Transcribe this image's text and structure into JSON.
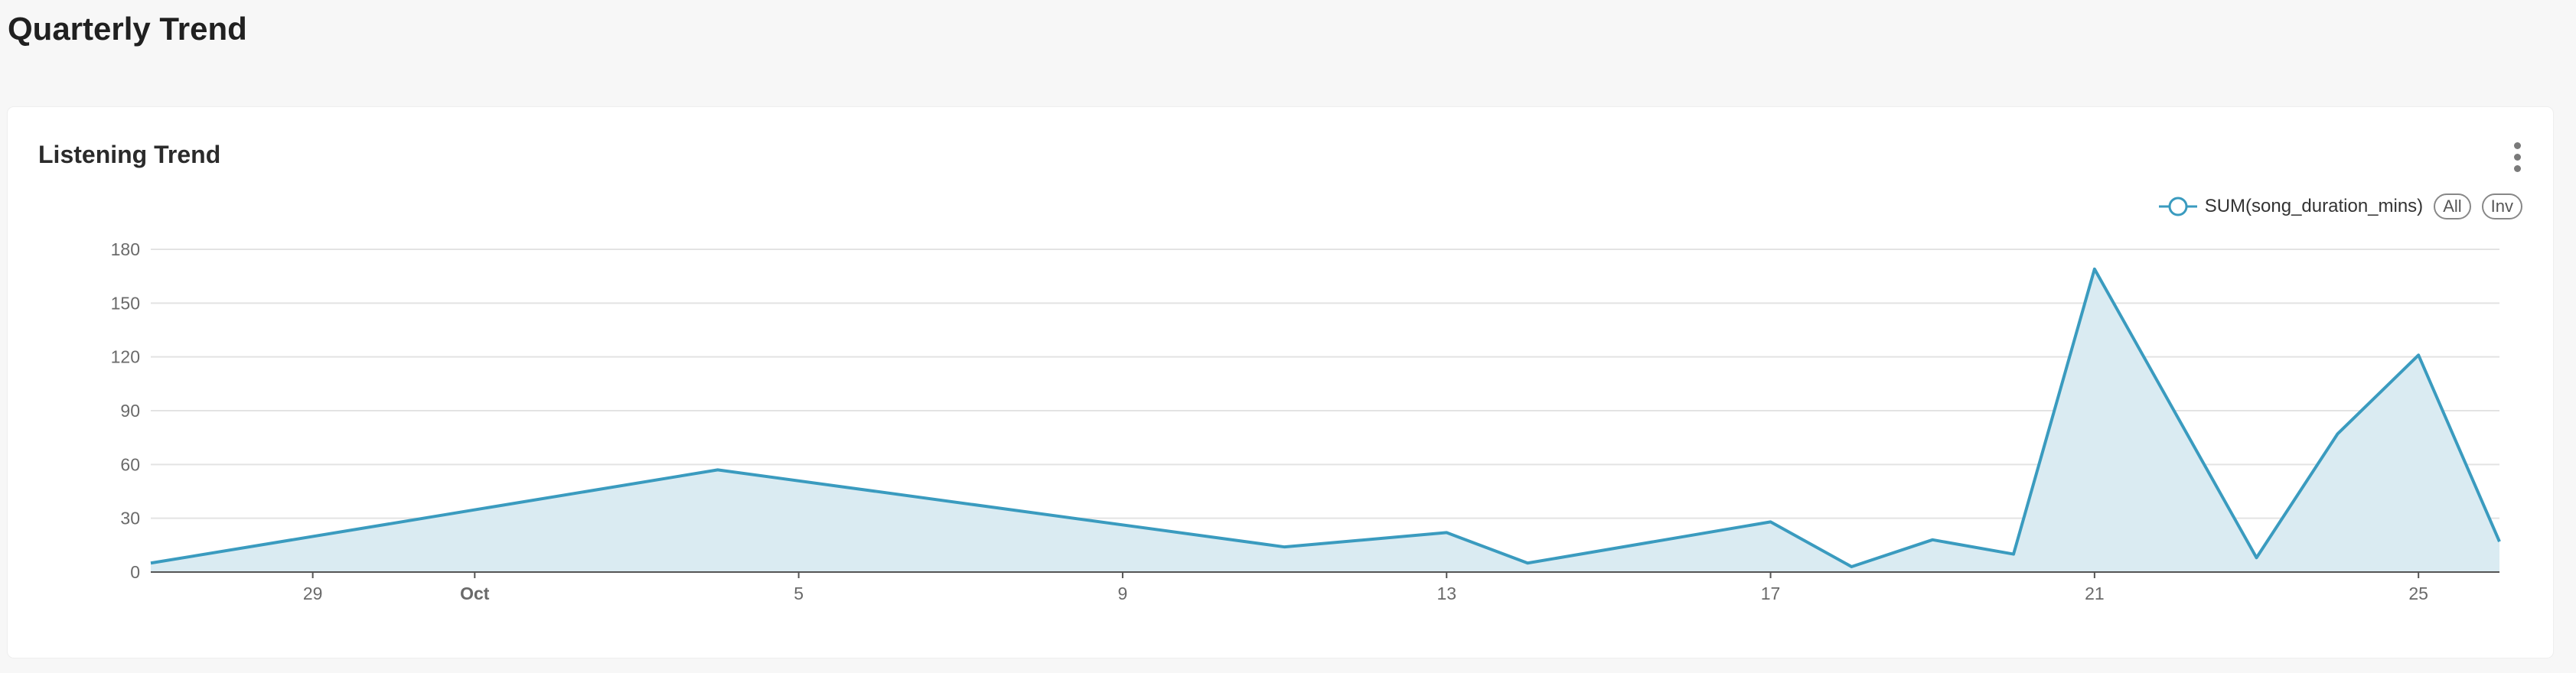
{
  "page": {
    "title": "Quarterly Trend"
  },
  "card": {
    "title": "Listening Trend",
    "menu_icon": "more-vertical-icon"
  },
  "legend": {
    "series_label": "SUM(song_duration_mins)",
    "all_label": "All",
    "inv_label": "Inv",
    "marker_icon": "circle-line-marker-icon"
  },
  "colors": {
    "series_line": "#3a9bbf",
    "series_fill": "#daebf2",
    "grid": "#e3e3e3",
    "axis": "#555555"
  },
  "chart_data": {
    "type": "area",
    "x": [
      "Sep 27",
      "Oct 4",
      "Oct 11",
      "Oct 13",
      "Oct 14",
      "Oct 17",
      "Oct 18",
      "Oct 19",
      "Oct 20",
      "Oct 21",
      "Oct 23",
      "Oct 24",
      "Oct 25",
      "Oct 26"
    ],
    "series": [
      {
        "name": "SUM(song_duration_mins)",
        "values": [
          5,
          57,
          14,
          22,
          5,
          28,
          3,
          18,
          10,
          169,
          8,
          77,
          121,
          17
        ]
      }
    ],
    "ylim": [
      0,
      180
    ],
    "yticks": [
      0,
      30,
      60,
      90,
      120,
      150,
      180
    ],
    "xticks": [
      {
        "date": "Sep 29",
        "label": "29",
        "bold": false
      },
      {
        "date": "Oct 1",
        "label": "Oct",
        "bold": true
      },
      {
        "date": "Oct 5",
        "label": "5",
        "bold": false
      },
      {
        "date": "Oct 9",
        "label": "9",
        "bold": false
      },
      {
        "date": "Oct 13",
        "label": "13",
        "bold": false
      },
      {
        "date": "Oct 17",
        "label": "17",
        "bold": false
      },
      {
        "date": "Oct 21",
        "label": "21",
        "bold": false
      },
      {
        "date": "Oct 25",
        "label": "25",
        "bold": false
      }
    ],
    "grid": true,
    "legend_position": "top-right",
    "xlabel": "",
    "ylabel": ""
  }
}
